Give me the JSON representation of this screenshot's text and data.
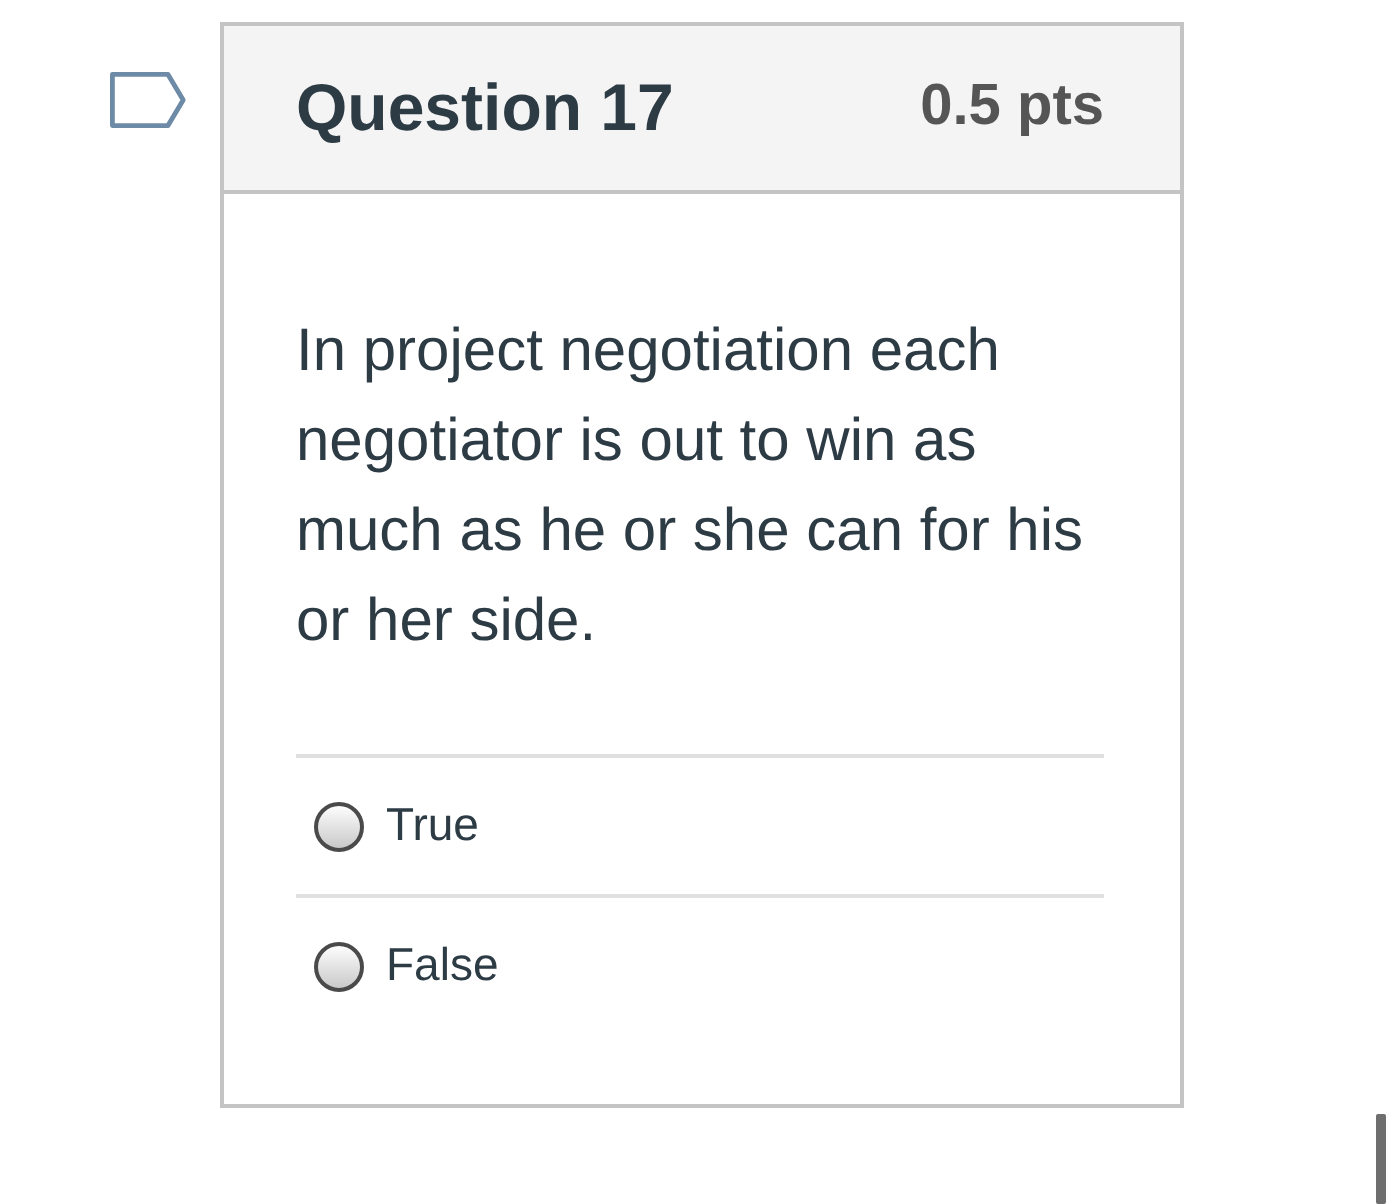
{
  "question": {
    "flagged": false,
    "title": "Question 17",
    "points": "0.5 pts",
    "text": "In project negotiation each negotiator is out to win as much as he or she can for his or her side.",
    "answers": [
      {
        "label": "True",
        "selected": false
      },
      {
        "label": "False",
        "selected": false
      }
    ]
  }
}
